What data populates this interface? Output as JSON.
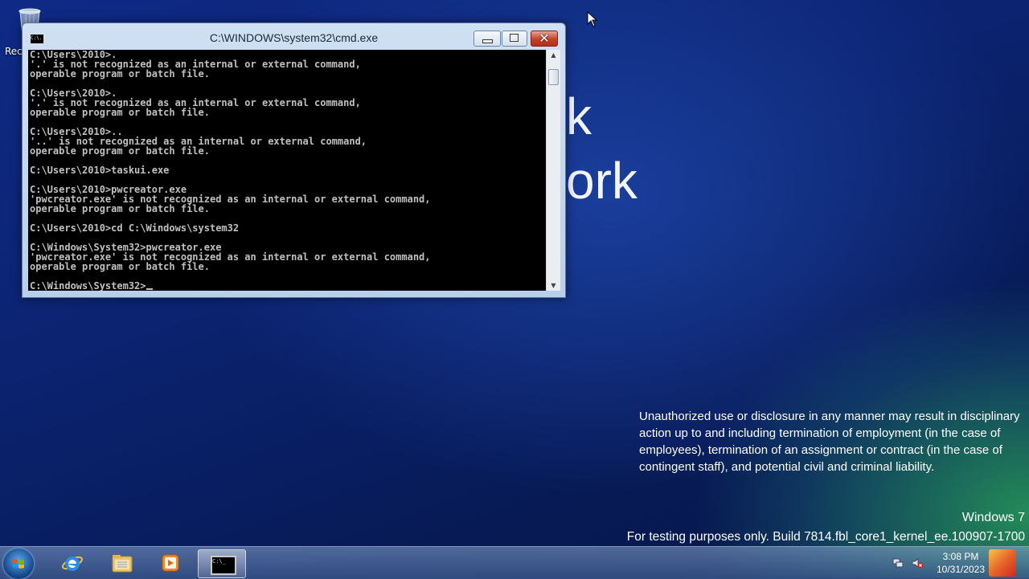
{
  "desktop": {
    "recycle_bin_label": "Rec",
    "background_text_line1": "k",
    "background_text_line2": "ork",
    "notice": "Unauthorized use or disclosure in any manner may result in disciplinary action up to and including termination of employment (in the case of employees), termination of an assignment or contract (in the case of contingent staff), and potential civil and criminal liability.",
    "windows_version": "Windows 7",
    "build_text": "For testing purposes only. Build 7814.fbl_core1_kernel_ee.100907-1700"
  },
  "cmd_window": {
    "title": "C:\\WINDOWS\\system32\\cmd.exe",
    "icon_text": "C:\\.",
    "close_glyph": "✕",
    "lines": [
      "C:\\Users\\2010>.",
      "'.' is not recognized as an internal or external command,",
      "operable program or batch file.",
      "",
      "C:\\Users\\2010>.",
      "'.' is not recognized as an internal or external command,",
      "operable program or batch file.",
      "",
      "C:\\Users\\2010>..",
      "'..' is not recognized as an internal or external command,",
      "operable program or batch file.",
      "",
      "C:\\Users\\2010>taskui.exe",
      "",
      "C:\\Users\\2010>pwcreator.exe",
      "'pwcreator.exe' is not recognized as an internal or external command,",
      "operable program or batch file.",
      "",
      "C:\\Users\\2010>cd C:\\Windows\\system32",
      "",
      "C:\\Windows\\System32>pwcreator.exe",
      "'pwcreator.exe' is not recognized as an internal or external command,",
      "operable program or batch file.",
      ""
    ],
    "prompt": "C:\\Windows\\System32>"
  },
  "taskbar": {
    "cmd_icon_text": "C:\\_",
    "clock_time": "3:08 PM",
    "clock_date": "10/31/2023"
  },
  "colors": {
    "console_bg": "#000000",
    "console_fg": "#c0c0c0",
    "close_button": "#c6402a"
  }
}
